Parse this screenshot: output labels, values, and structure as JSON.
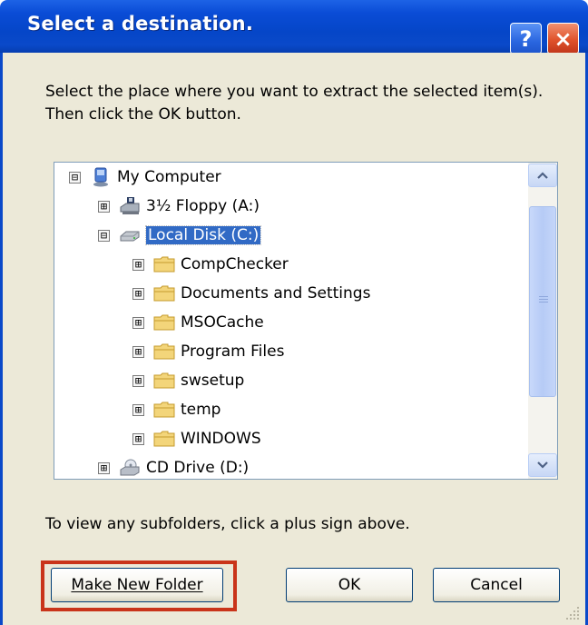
{
  "dialog": {
    "title": "Select a destination.",
    "help_glyph": "?",
    "close_glyph": "×",
    "instructions": "Select the place where you want to extract the selected item(s).  Then click the OK button.",
    "hint": "To view any subfolders, click a plus sign above."
  },
  "tree": {
    "items": [
      {
        "label": "My Computer",
        "expander": "⊟",
        "icon": "computer-icon"
      },
      {
        "label": "3½ Floppy (A:)",
        "expander": "⊞",
        "icon": "floppy-drive-icon"
      },
      {
        "label": "Local Disk (C:)",
        "expander": "⊟",
        "icon": "hard-disk-icon",
        "selected": true
      },
      {
        "label": "CompChecker",
        "expander": "⊞",
        "icon": "folder-icon"
      },
      {
        "label": "Documents and Settings",
        "expander": "⊞",
        "icon": "folder-icon"
      },
      {
        "label": "MSOCache",
        "expander": "⊞",
        "icon": "folder-icon"
      },
      {
        "label": "Program Files",
        "expander": "⊞",
        "icon": "folder-icon"
      },
      {
        "label": "swsetup",
        "expander": "⊞",
        "icon": "folder-icon"
      },
      {
        "label": "temp",
        "expander": "⊞",
        "icon": "folder-icon"
      },
      {
        "label": "WINDOWS",
        "expander": "⊞",
        "icon": "folder-icon"
      },
      {
        "label": "CD Drive (D:)",
        "expander": "⊞",
        "icon": "cd-drive-icon"
      }
    ]
  },
  "buttons": {
    "make_new_folder": "Make New Folder",
    "ok": "OK",
    "cancel": "Cancel"
  },
  "colors": {
    "titlebar": "#0a49c9",
    "selection": "#316ac5",
    "highlight_frame": "#c9341a"
  }
}
